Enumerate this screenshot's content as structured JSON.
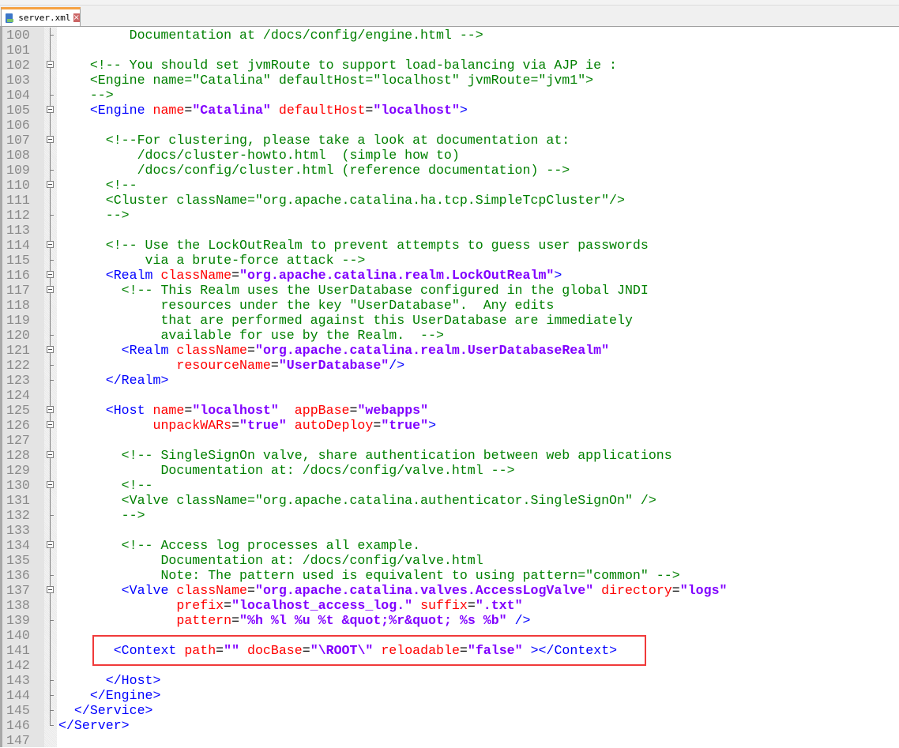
{
  "tab": {
    "label": "server.xml",
    "close": "×"
  },
  "colors": {
    "comment": "#008000",
    "tag": "#0000ff",
    "attr": "#ff0000",
    "value": "#8000ff",
    "highlight": "#f03a3a"
  },
  "lines": [
    {
      "n": "100",
      "tokens": [
        {
          "k": "c",
          "text": "         Documentation at /docs/config/engine.html -->"
        }
      ]
    },
    {
      "n": "101",
      "tokens": []
    },
    {
      "n": "102",
      "tokens": [
        {
          "k": "c",
          "text": "    <!-- You should set jvmRoute to support load-balancing via AJP ie :"
        }
      ]
    },
    {
      "n": "103",
      "tokens": [
        {
          "k": "c",
          "text": "    <Engine name=\"Catalina\" defaultHost=\"localhost\" jvmRoute=\"jvm1\">"
        }
      ]
    },
    {
      "n": "104",
      "tokens": [
        {
          "k": "c",
          "text": "    -->"
        }
      ]
    },
    {
      "n": "105",
      "tokens": [
        {
          "k": "t",
          "text": "    <Engine"
        },
        {
          "k": "a",
          "text": " name"
        },
        {
          "k": "p",
          "text": "="
        },
        {
          "k": "v",
          "text": "\"Catalina\""
        },
        {
          "k": "a",
          "text": " defaultHost"
        },
        {
          "k": "p",
          "text": "="
        },
        {
          "k": "v",
          "text": "\"localhost\""
        },
        {
          "k": "t",
          "text": ">"
        }
      ]
    },
    {
      "n": "106",
      "tokens": []
    },
    {
      "n": "107",
      "tokens": [
        {
          "k": "c",
          "text": "      <!--For clustering, please take a look at documentation at:"
        }
      ]
    },
    {
      "n": "108",
      "tokens": [
        {
          "k": "c",
          "text": "          /docs/cluster-howto.html  (simple how to)"
        }
      ]
    },
    {
      "n": "109",
      "tokens": [
        {
          "k": "c",
          "text": "          /docs/config/cluster.html (reference documentation) -->"
        }
      ]
    },
    {
      "n": "110",
      "tokens": [
        {
          "k": "c",
          "text": "      <!--"
        }
      ]
    },
    {
      "n": "111",
      "tokens": [
        {
          "k": "c",
          "text": "      <Cluster className=\"org.apache.catalina.ha.tcp.SimpleTcpCluster\"/>"
        }
      ]
    },
    {
      "n": "112",
      "tokens": [
        {
          "k": "c",
          "text": "      -->"
        }
      ]
    },
    {
      "n": "113",
      "tokens": []
    },
    {
      "n": "114",
      "tokens": [
        {
          "k": "c",
          "text": "      <!-- Use the LockOutRealm to prevent attempts to guess user passwords"
        }
      ]
    },
    {
      "n": "115",
      "tokens": [
        {
          "k": "c",
          "text": "           via a brute-force attack -->"
        }
      ]
    },
    {
      "n": "116",
      "tokens": [
        {
          "k": "t",
          "text": "      <Realm"
        },
        {
          "k": "a",
          "text": " className"
        },
        {
          "k": "p",
          "text": "="
        },
        {
          "k": "v",
          "text": "\"org.apache.catalina.realm.LockOutRealm\""
        },
        {
          "k": "t",
          "text": ">"
        }
      ]
    },
    {
      "n": "117",
      "tokens": [
        {
          "k": "c",
          "text": "        <!-- This Realm uses the UserDatabase configured in the global JNDI"
        }
      ]
    },
    {
      "n": "118",
      "tokens": [
        {
          "k": "c",
          "text": "             resources under the key \"UserDatabase\".  Any edits"
        }
      ]
    },
    {
      "n": "119",
      "tokens": [
        {
          "k": "c",
          "text": "             that are performed against this UserDatabase are immediately"
        }
      ]
    },
    {
      "n": "120",
      "tokens": [
        {
          "k": "c",
          "text": "             available for use by the Realm.  -->"
        }
      ]
    },
    {
      "n": "121",
      "tokens": [
        {
          "k": "t",
          "text": "        <Realm"
        },
        {
          "k": "a",
          "text": " className"
        },
        {
          "k": "p",
          "text": "="
        },
        {
          "k": "v",
          "text": "\"org.apache.catalina.realm.UserDatabaseRealm\""
        }
      ]
    },
    {
      "n": "122",
      "tokens": [
        {
          "k": "a",
          "text": "               resourceName"
        },
        {
          "k": "p",
          "text": "="
        },
        {
          "k": "v",
          "text": "\"UserDatabase\""
        },
        {
          "k": "t",
          "text": "/>"
        }
      ]
    },
    {
      "n": "123",
      "tokens": [
        {
          "k": "t",
          "text": "      </Realm>"
        }
      ]
    },
    {
      "n": "124",
      "tokens": []
    },
    {
      "n": "125",
      "tokens": [
        {
          "k": "t",
          "text": "      <Host"
        },
        {
          "k": "a",
          "text": " name"
        },
        {
          "k": "p",
          "text": "="
        },
        {
          "k": "v",
          "text": "\"localhost\""
        },
        {
          "k": "a",
          "text": "  appBase"
        },
        {
          "k": "p",
          "text": "="
        },
        {
          "k": "v",
          "text": "\"webapps\""
        }
      ]
    },
    {
      "n": "126",
      "tokens": [
        {
          "k": "a",
          "text": "            unpackWARs"
        },
        {
          "k": "p",
          "text": "="
        },
        {
          "k": "v",
          "text": "\"true\""
        },
        {
          "k": "a",
          "text": " autoDeploy"
        },
        {
          "k": "p",
          "text": "="
        },
        {
          "k": "v",
          "text": "\"true\""
        },
        {
          "k": "t",
          "text": ">"
        }
      ]
    },
    {
      "n": "127",
      "tokens": []
    },
    {
      "n": "128",
      "tokens": [
        {
          "k": "c",
          "text": "        <!-- SingleSignOn valve, share authentication between web applications"
        }
      ]
    },
    {
      "n": "129",
      "tokens": [
        {
          "k": "c",
          "text": "             Documentation at: /docs/config/valve.html -->"
        }
      ]
    },
    {
      "n": "130",
      "tokens": [
        {
          "k": "c",
          "text": "        <!--"
        }
      ]
    },
    {
      "n": "131",
      "tokens": [
        {
          "k": "c",
          "text": "        <Valve className=\"org.apache.catalina.authenticator.SingleSignOn\" />"
        }
      ]
    },
    {
      "n": "132",
      "tokens": [
        {
          "k": "c",
          "text": "        -->"
        }
      ]
    },
    {
      "n": "133",
      "tokens": []
    },
    {
      "n": "134",
      "tokens": [
        {
          "k": "c",
          "text": "        <!-- Access log processes all example."
        }
      ]
    },
    {
      "n": "135",
      "tokens": [
        {
          "k": "c",
          "text": "             Documentation at: /docs/config/valve.html"
        }
      ]
    },
    {
      "n": "136",
      "tokens": [
        {
          "k": "c",
          "text": "             Note: The pattern used is equivalent to using pattern=\"common\" -->"
        }
      ]
    },
    {
      "n": "137",
      "tokens": [
        {
          "k": "t",
          "text": "        <Valve"
        },
        {
          "k": "a",
          "text": " className"
        },
        {
          "k": "p",
          "text": "="
        },
        {
          "k": "v",
          "text": "\"org.apache.catalina.valves.AccessLogValve\""
        },
        {
          "k": "a",
          "text": " directory"
        },
        {
          "k": "p",
          "text": "="
        },
        {
          "k": "v",
          "text": "\"logs\""
        }
      ]
    },
    {
      "n": "138",
      "tokens": [
        {
          "k": "a",
          "text": "               prefix"
        },
        {
          "k": "p",
          "text": "="
        },
        {
          "k": "v",
          "text": "\"localhost_access_log.\""
        },
        {
          "k": "a",
          "text": " suffix"
        },
        {
          "k": "p",
          "text": "="
        },
        {
          "k": "v",
          "text": "\".txt\""
        }
      ]
    },
    {
      "n": "139",
      "tokens": [
        {
          "k": "a",
          "text": "               pattern"
        },
        {
          "k": "p",
          "text": "="
        },
        {
          "k": "v",
          "text": "\"%h %l %u %t &quot;%r&quot; %s %b\""
        },
        {
          "k": "t",
          "text": " />"
        }
      ]
    },
    {
      "n": "140",
      "tokens": []
    },
    {
      "n": "141",
      "tokens": [
        {
          "k": "t",
          "text": "       <Context"
        },
        {
          "k": "a",
          "text": " path"
        },
        {
          "k": "p",
          "text": "="
        },
        {
          "k": "v",
          "text": "\"\""
        },
        {
          "k": "a",
          "text": " docBase"
        },
        {
          "k": "p",
          "text": "="
        },
        {
          "k": "v",
          "text": "\"\\ROOT\\\""
        },
        {
          "k": "a",
          "text": " reloadable"
        },
        {
          "k": "p",
          "text": "="
        },
        {
          "k": "v",
          "text": "\"false\""
        },
        {
          "k": "t",
          "text": " ></Context>"
        }
      ]
    },
    {
      "n": "142",
      "tokens": []
    },
    {
      "n": "143",
      "tokens": [
        {
          "k": "t",
          "text": "      </Host>"
        }
      ]
    },
    {
      "n": "144",
      "tokens": [
        {
          "k": "t",
          "text": "    </Engine>"
        }
      ]
    },
    {
      "n": "145",
      "tokens": [
        {
          "k": "t",
          "text": "  </Service>"
        }
      ]
    },
    {
      "n": "146",
      "tokens": [
        {
          "k": "t",
          "text": "</Server>"
        }
      ]
    },
    {
      "n": "147",
      "tokens": []
    }
  ]
}
